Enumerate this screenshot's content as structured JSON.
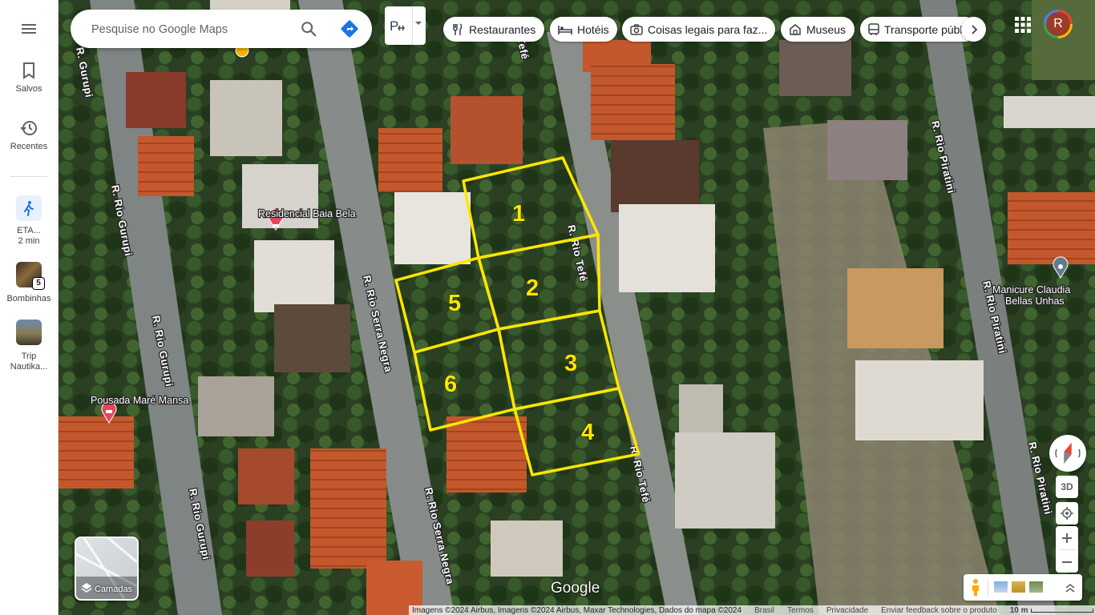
{
  "rail": {
    "saved_label": "Salvos",
    "recents_label": "Recentes",
    "eta_label": "ETA...",
    "eta_time": "2 min",
    "saved_items": [
      {
        "label": "Bombinhas",
        "badge": "5"
      },
      {
        "label": "Trip Nautika..."
      }
    ]
  },
  "search": {
    "placeholder": "Pesquise no Google Maps"
  },
  "transit_mode": {
    "icon": "transit-layer-icon"
  },
  "chips": [
    {
      "label": "Restaurantes",
      "icon": "fork-knife-icon"
    },
    {
      "label": "Hotéis",
      "icon": "bed-icon"
    },
    {
      "label": "Coisas legais para faz...",
      "icon": "camera-icon"
    },
    {
      "label": "Museus",
      "icon": "museum-icon"
    },
    {
      "label": "Transporte públ",
      "icon": "bus-icon"
    }
  ],
  "account": {
    "avatar_letter": "R"
  },
  "map": {
    "streets": [
      "R. Gurupi",
      "R. Rio Gurupi",
      "R. Rio Gurupi",
      "R. Rio Gurupi",
      "R. Rio Serra Negra",
      "R. Rio Serra Negra",
      "R. Rio Tefé",
      "R. Rio Tefé",
      "Tefé",
      "R. Rio Piratini",
      "R. Rio Piratini",
      "R. Rio Piratini"
    ],
    "pois": [
      {
        "name": "Residencial Baia Bela",
        "type": "hotel"
      },
      {
        "name": "Pousada Maré Mansa",
        "type": "hotel"
      },
      {
        "name": "Manicure Claudia Bellas Unhas",
        "line1": "Manicure Claudia",
        "line2": "Bellas Unhas",
        "type": "place"
      }
    ],
    "lots": [
      "1",
      "2",
      "3",
      "4",
      "5",
      "6"
    ],
    "lot_color": "#ffe600"
  },
  "controls": {
    "layers_label": "Camadas",
    "btn_3d": "3D"
  },
  "footer": {
    "logo": "Google",
    "imagery": "Imagens ©2024 Airbus, Imagens ©2024 Airbus, Maxar Technologies, Dados do mapa ©2024",
    "country": "Brasil",
    "terms": "Termos",
    "privacy": "Privacidade",
    "feedback": "Enviar feedback sobre o produto",
    "scale": "10 m"
  }
}
